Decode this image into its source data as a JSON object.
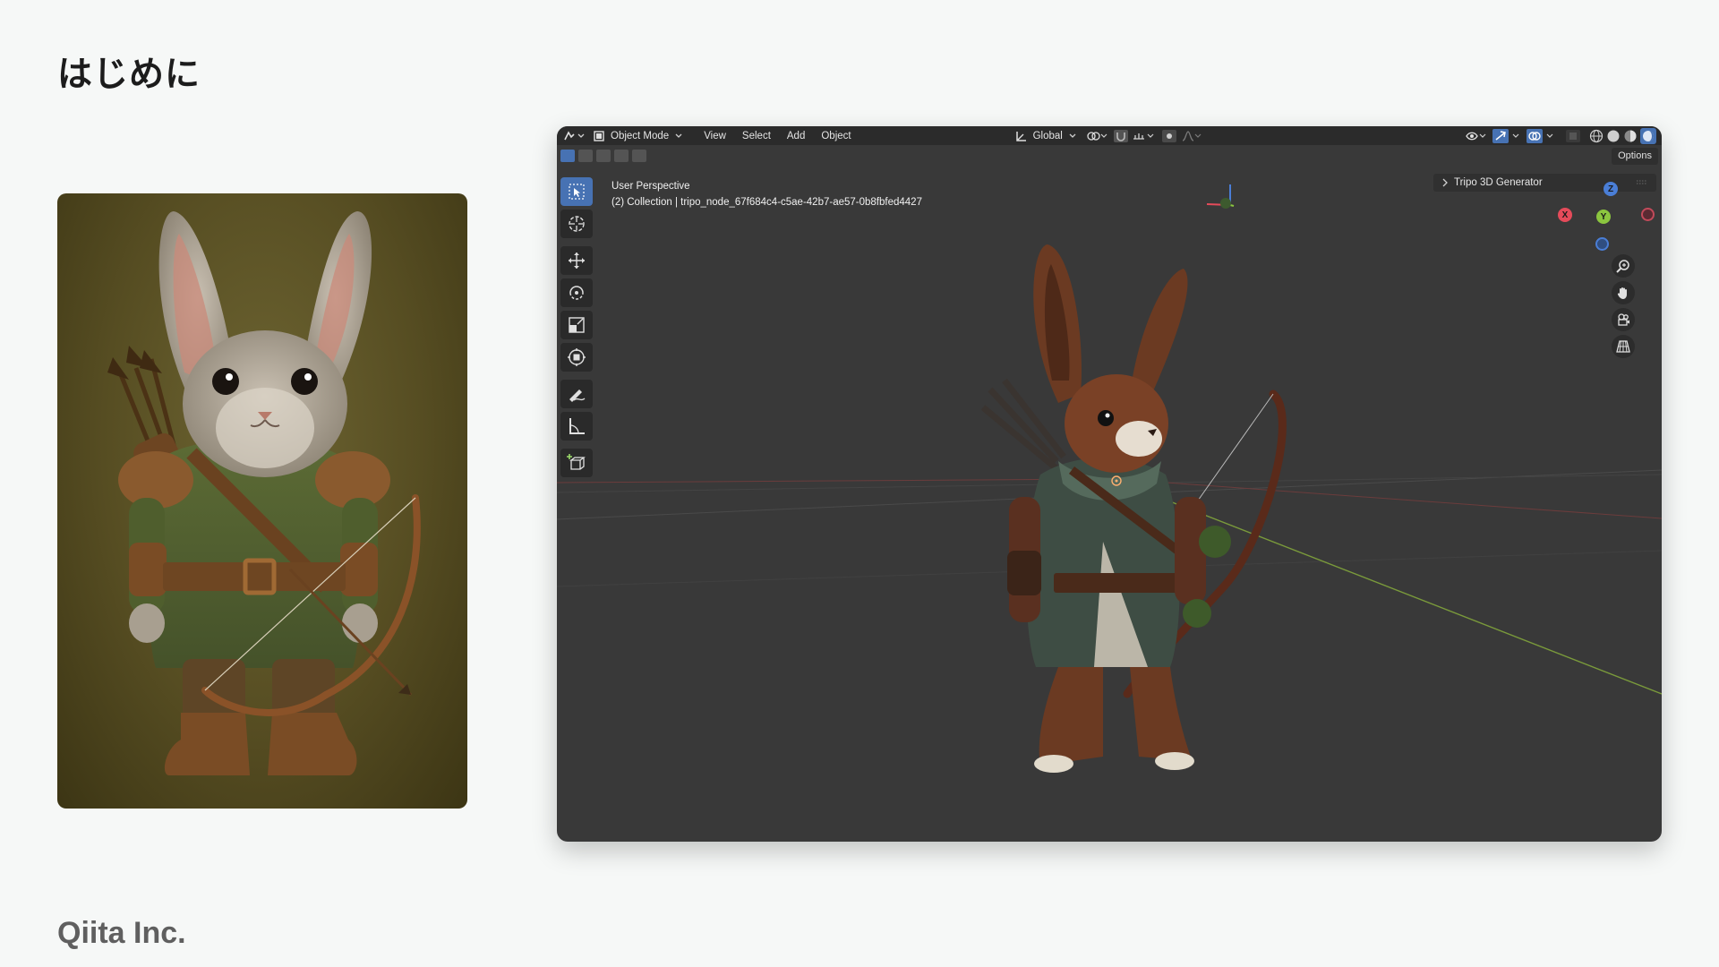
{
  "slide": {
    "title": "はじめに",
    "footer_brand": "Qiita Inc."
  },
  "concept_art": {
    "subject": "rabbit-archer-illustration"
  },
  "blender": {
    "header": {
      "editor_type_icon": "editor-type-icon",
      "mode": "Object Mode",
      "menus": [
        "View",
        "Select",
        "Add",
        "Object"
      ],
      "transform_orientation": "Global"
    },
    "options_label": "Options",
    "viewport": {
      "perspective": "User Perspective",
      "collection_line": "(2) Collection | tripo_node_67f684c4-c5ae-42b7-ae57-0b8fbfed4427"
    },
    "sidebar_panel": {
      "title": "Tripo 3D Generator"
    },
    "gizmo": {
      "axes": [
        "Z",
        "X",
        "Y"
      ]
    },
    "tools": [
      "select-box-icon",
      "cursor-icon",
      "move-icon",
      "rotate-icon",
      "scale-icon",
      "transform-icon",
      "annotate-icon",
      "measure-icon",
      "add-cube-icon"
    ],
    "colors": {
      "header_bg": "#2b2b2b",
      "viewport_bg": "#393939",
      "accent": "#4772b3",
      "axis_x": "#e54b5a",
      "axis_y": "#8bc53f",
      "axis_z": "#4a7ed6"
    }
  }
}
